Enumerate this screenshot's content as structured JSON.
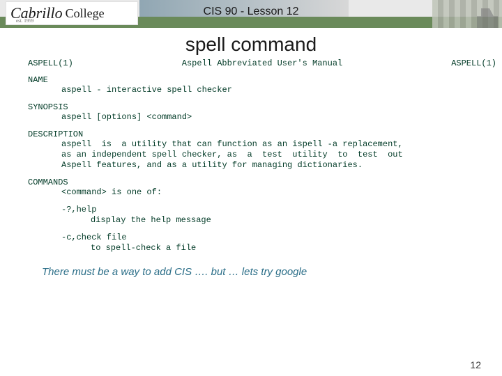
{
  "banner": {
    "logo_script": "Cabrillo",
    "logo_plain": "College",
    "logo_est": "est. 1959",
    "course_title": "CIS 90 - Lesson 12"
  },
  "slide": {
    "title": "spell command",
    "page_number": "12"
  },
  "man": {
    "hdr_left": "ASPELL(1)",
    "hdr_center": "Aspell Abbreviated User's Manual",
    "hdr_right": "ASPELL(1)",
    "name_head": "NAME",
    "name_body": "aspell - interactive spell checker",
    "syn_head": "SYNOPSIS",
    "syn_body": "aspell [options] <command>",
    "desc_head": "DESCRIPTION",
    "desc_l1": "aspell  is  a utility that can function as an ispell -a replacement,",
    "desc_l2": "as an independent spell checker, as  a  test  utility  to  test  out",
    "desc_l3": "Aspell features, and as a utility for managing dictionaries.",
    "cmd_head": "COMMANDS",
    "cmd_intro": "<command> is one of:",
    "cmd_help_k": "-?,help",
    "cmd_help_v": "display the help message",
    "cmd_check_k": "-c,check file",
    "cmd_check_v": "to spell-check a file"
  },
  "note": {
    "text": "There must be a way to add CIS …. but  … lets try google"
  }
}
